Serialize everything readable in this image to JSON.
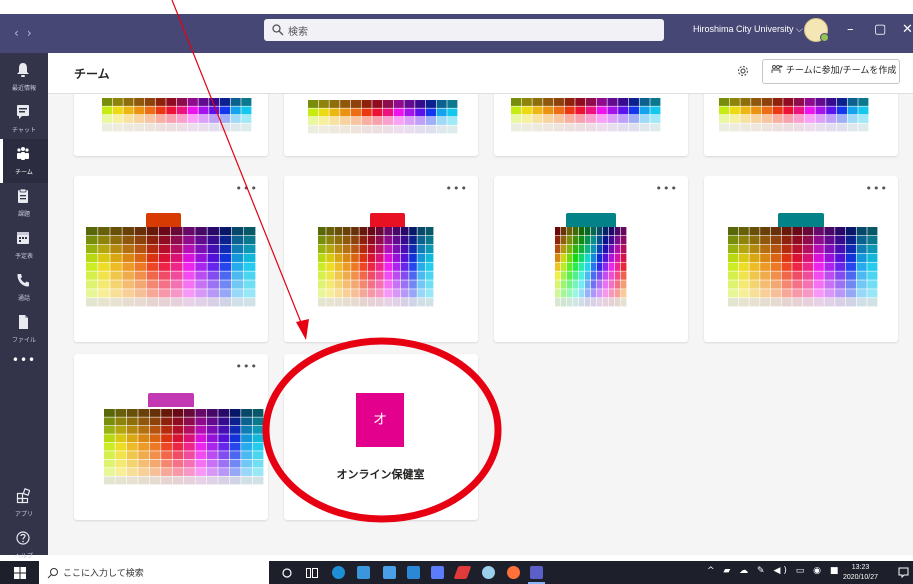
{
  "titlebar": {
    "search_placeholder": "検索",
    "organization": "Hiroshima City University",
    "org_chevron": "⌵",
    "nav_back": "‹",
    "nav_forward": "›",
    "minimize": "–",
    "maximize": "▢",
    "close": "✕"
  },
  "rail": {
    "items": [
      {
        "label": "最近情報",
        "icon": "bell-icon"
      },
      {
        "label": "チャット",
        "icon": "chat-icon"
      },
      {
        "label": "チーム",
        "icon": "teams-icon"
      },
      {
        "label": "課題",
        "icon": "assignments-icon"
      },
      {
        "label": "予定表",
        "icon": "calendar-icon"
      },
      {
        "label": "通話",
        "icon": "phone-icon"
      },
      {
        "label": "ファイル",
        "icon": "file-icon"
      }
    ],
    "more": "•••",
    "apps_label": "アプリ",
    "help_label": "ヘルプ"
  },
  "header": {
    "title": "チーム",
    "join_label": "チームに参加/チームを作成"
  },
  "cards": {
    "more": "•••",
    "tab_colors": [
      "#d83b01",
      "#e81123",
      "#038387",
      "#038387",
      "#c239b3"
    ],
    "new_team": {
      "initial": "オ",
      "name": "オンライン保健室",
      "color": "#e3008c"
    }
  },
  "annotation": {
    "color": "#e60012"
  },
  "taskbar": {
    "search_text": "ここに入力して検索",
    "time": "13:23",
    "date": "2020/10/27"
  }
}
